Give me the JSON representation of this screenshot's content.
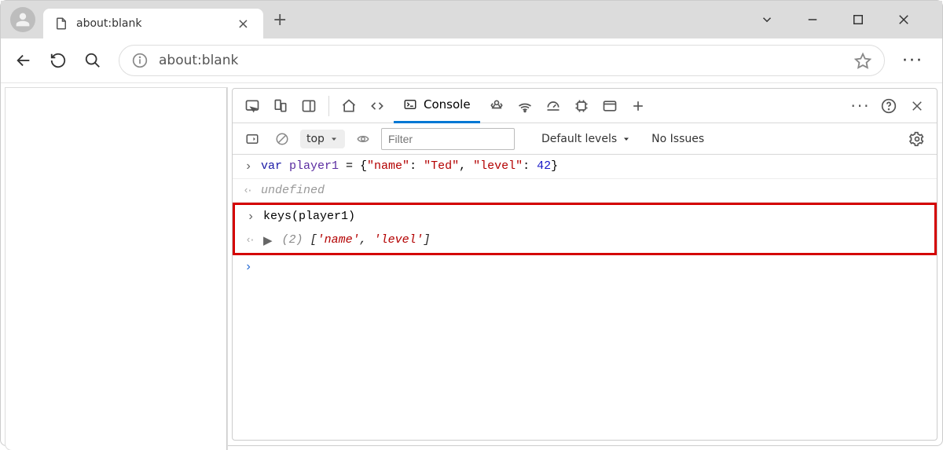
{
  "window": {
    "tab_title": "about:blank",
    "url": "about:blank"
  },
  "devtools": {
    "tabs": {
      "console_label": "Console"
    },
    "console_toolbar": {
      "context": "top",
      "filter_placeholder": "Filter",
      "levels_label": "Default levels",
      "issues_label": "No Issues"
    },
    "console_lines": {
      "line1_kw": "var",
      "line1_ident": " player1 ",
      "line1_eq": "= {",
      "line1_k1": "\"name\"",
      "line1_c1": ": ",
      "line1_v1": "\"Ted\"",
      "line1_c2": ", ",
      "line1_k2": "\"level\"",
      "line1_c3": ": ",
      "line1_v2": "42",
      "line1_end": "}",
      "line2": "undefined",
      "line3_fn": "keys",
      "line3_arg": "(player1)",
      "line4_count": "(2) ",
      "line4_open": "[",
      "line4_e1": "'name'",
      "line4_comma": ", ",
      "line4_e2": "'level'",
      "line4_close": "]"
    }
  }
}
